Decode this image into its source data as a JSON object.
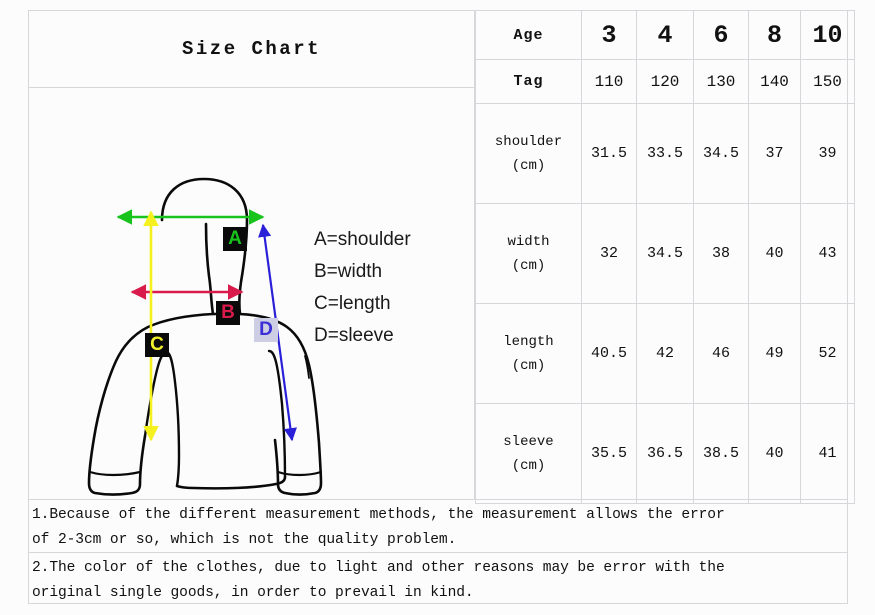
{
  "title": "Size Chart",
  "legend": {
    "items": [
      "A=shoulder",
      "B=width",
      "C=length",
      "D=sleeve"
    ]
  },
  "diagram": {
    "badges": [
      {
        "label": "A",
        "meaning": "shoulder",
        "text_color": "#18c31c",
        "bg_color": "#0a0a0a",
        "arrow_color": "#18c31c"
      },
      {
        "label": "B",
        "meaning": "width",
        "text_color": "#d81b4a",
        "bg_color": "#0a0a0a",
        "arrow_color": "#d81b4a"
      },
      {
        "label": "C",
        "meaning": "length",
        "text_color": "#f2f02a",
        "bg_color": "#0a0a0a",
        "arrow_color": "#f5f11f"
      },
      {
        "label": "D",
        "meaning": "sleeve",
        "text_color": "#3b2fd6",
        "bg_color": "#cdcee4",
        "arrow_color": "#2a20d8"
      }
    ],
    "garment_outline_color": "#0a0a0a"
  },
  "table": {
    "header_age_label": "Age",
    "header_tag_label": "Tag",
    "ages": [
      "3",
      "4",
      "6",
      "8",
      "10"
    ],
    "tags": [
      "110",
      "120",
      "130",
      "140",
      "150"
    ],
    "unit": "(cm)",
    "rows": [
      {
        "name": "shoulder",
        "unit": "(cm)",
        "values": [
          "31.5",
          "33.5",
          "34.5",
          "37",
          "39"
        ]
      },
      {
        "name": "width",
        "unit": "(cm)",
        "values": [
          "32",
          "34.5",
          "38",
          "40",
          "43"
        ]
      },
      {
        "name": "length",
        "unit": "(cm)",
        "values": [
          "40.5",
          "42",
          "46",
          "49",
          "52"
        ]
      },
      {
        "name": "sleeve",
        "unit": "(cm)",
        "values": [
          "35.5",
          "36.5",
          "38.5",
          "40",
          "41"
        ]
      }
    ]
  },
  "notes": {
    "note1_line1": "1.Because of the different measurement methods, the measurement allows the error",
    "note1_line2": "of 2-3cm or so, which is not the quality problem.",
    "note2_line1": "2.The color of the clothes, due to light and other reasons may be error with the",
    "note2_line2": "original single goods, in order to prevail in kind."
  }
}
